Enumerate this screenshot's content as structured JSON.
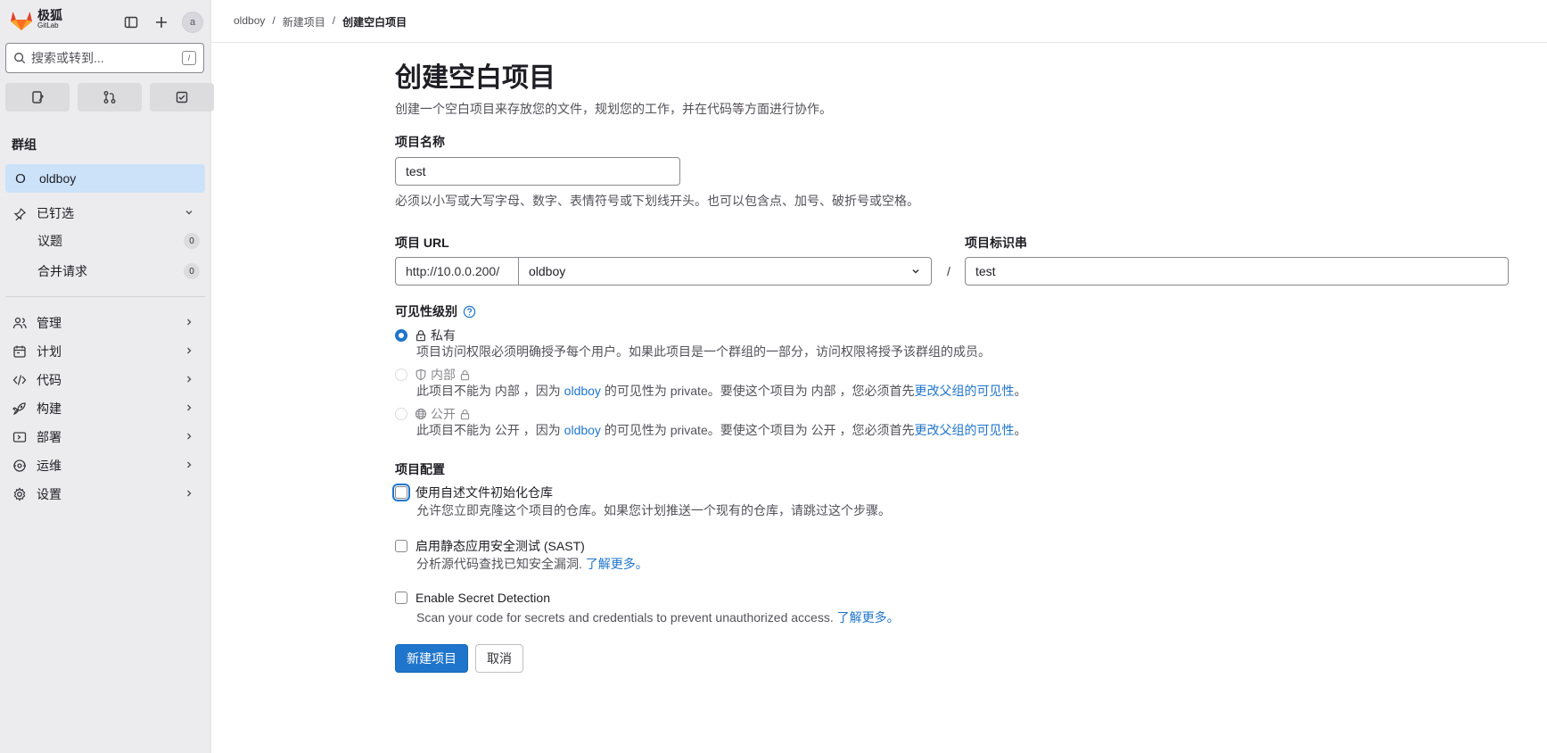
{
  "brand": {
    "name_cn": "极狐",
    "name_en": "GitLab",
    "brand_color": "#e24329"
  },
  "sidebar": {
    "avatar_alt": "a",
    "search_placeholder": "搜索或转到...",
    "search_shortcut": "/",
    "section_title": "群组",
    "group": {
      "initial": "O",
      "name": "oldboy"
    },
    "pinned": {
      "label": "已钉选",
      "items": [
        {
          "label": "议题",
          "count": "0"
        },
        {
          "label": "合并请求",
          "count": "0"
        }
      ]
    },
    "nav": [
      {
        "label": "管理",
        "icon": "users-icon"
      },
      {
        "label": "计划",
        "icon": "calendar-icon"
      },
      {
        "label": "代码",
        "icon": "code-icon"
      },
      {
        "label": "构建",
        "icon": "rocket-icon"
      },
      {
        "label": "部署",
        "icon": "deploy-icon"
      },
      {
        "label": "运维",
        "icon": "monitor-icon"
      },
      {
        "label": "设置",
        "icon": "gear-icon"
      }
    ]
  },
  "breadcrumb": {
    "items": [
      "oldboy",
      "新建项目",
      "创建空白项目"
    ],
    "separator": "/"
  },
  "page": {
    "title": "创建空白项目",
    "subtitle": "创建一个空白项目来存放您的文件，规划您的工作，并在代码等方面进行协作。"
  },
  "form": {
    "name_label": "项目名称",
    "name_value": "test",
    "name_help": "必须以小写或大写字母、数字、表情符号或下划线开头。也可以包含点、加号、破折号或空格。",
    "url_label": "项目 URL",
    "url_prefix": "http://10.0.0.200/",
    "url_namespace": "oldboy",
    "slug_separator": "/",
    "slug_label": "项目标识串",
    "slug_value": "test",
    "visibility_label": "可见性级别",
    "visibility": {
      "private_label": "私有",
      "private_help": "项目访问权限必须明确授予每个用户。如果此项目是一个群组的一部分，访问权限将授予该群组的成员。",
      "internal_label": "内部",
      "internal_help_prefix": "此项目不能为 内部 ，因为",
      "internal_help_group": "oldboy",
      "internal_help_middle": "的可见性为 private。要使这个项目为 内部 ，您必须首先",
      "internal_help_link": "更改父组的可见性",
      "internal_help_end": "。",
      "public_label": "公开",
      "public_help_prefix": "此项目不能为 公开 ，因为",
      "public_help_group": "oldboy",
      "public_help_middle": "的可见性为 private。要使这个项目为 公开 ，您必须首先",
      "public_help_link": "更改父组的可见性",
      "public_help_end": "。"
    },
    "config_label": "项目配置",
    "readme_label": "使用自述文件初始化仓库",
    "readme_help": "允许您立即克隆这个项目的仓库。如果您计划推送一个现有的仓库，请跳过这个步骤。",
    "sast_label": "启用静态应用安全测试 (SAST)",
    "sast_help": "分析源代码查找已知安全漏洞.",
    "sast_link": "了解更多。",
    "secret_label": "Enable Secret Detection",
    "secret_help": "Scan your code for secrets and credentials to prevent unauthorized access.",
    "secret_link": "了解更多。",
    "submit_label": "新建项目",
    "cancel_label": "取消"
  },
  "colors": {
    "primary": "#1f75cb",
    "active_nav": "#cbe2f9",
    "sidebar_bg": "#ececef"
  }
}
